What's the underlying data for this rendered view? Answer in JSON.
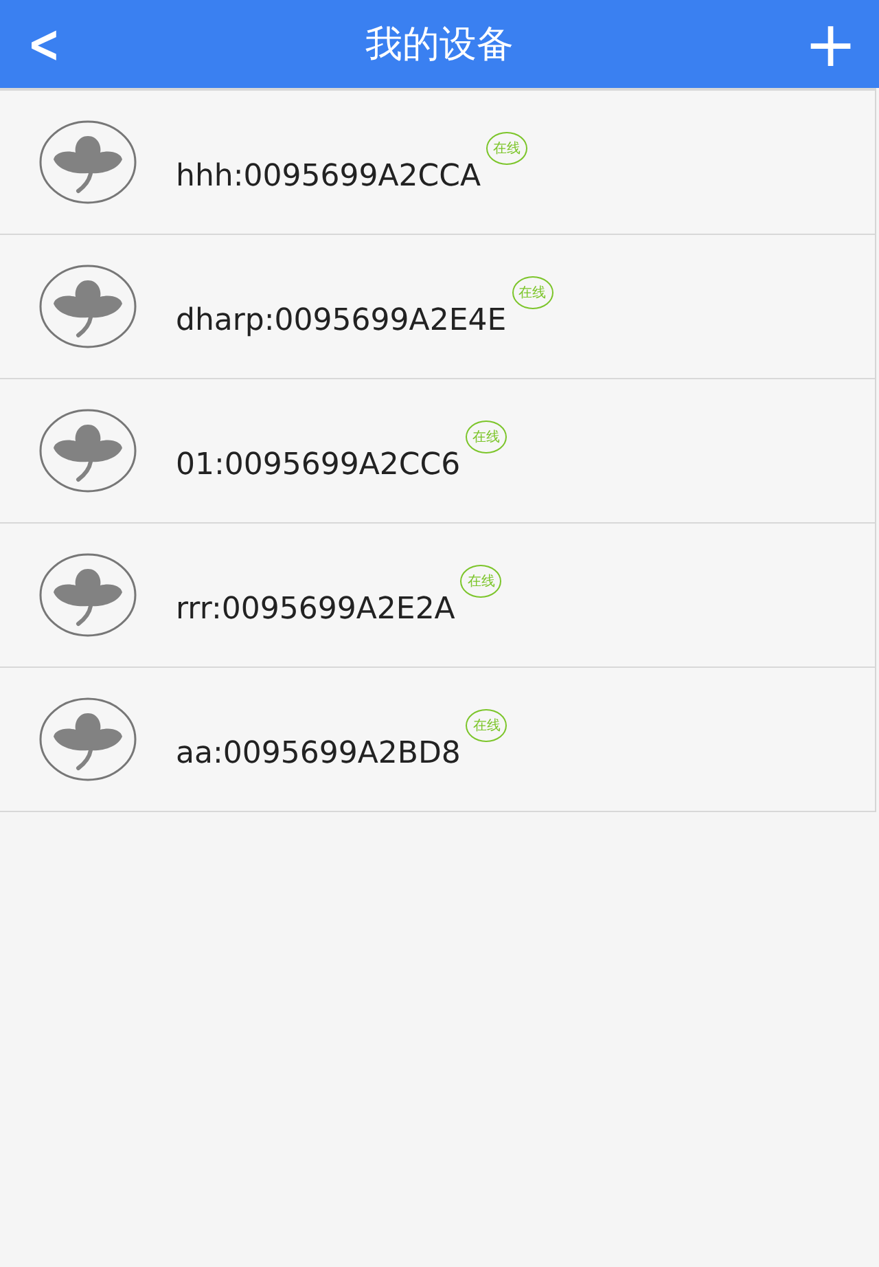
{
  "header": {
    "back": "<",
    "title": "我的设备",
    "add": "+"
  },
  "devices": [
    {
      "name": "hhh:0095699A2CCA",
      "status": "在线"
    },
    {
      "name": "dharp:0095699A2E4E",
      "status": "在线"
    },
    {
      "name": "01:0095699A2CC6",
      "status": "在线"
    },
    {
      "name": "rrr:0095699A2E2A",
      "status": "在线"
    },
    {
      "name": "aa:0095699A2BD8",
      "status": "在线"
    }
  ]
}
